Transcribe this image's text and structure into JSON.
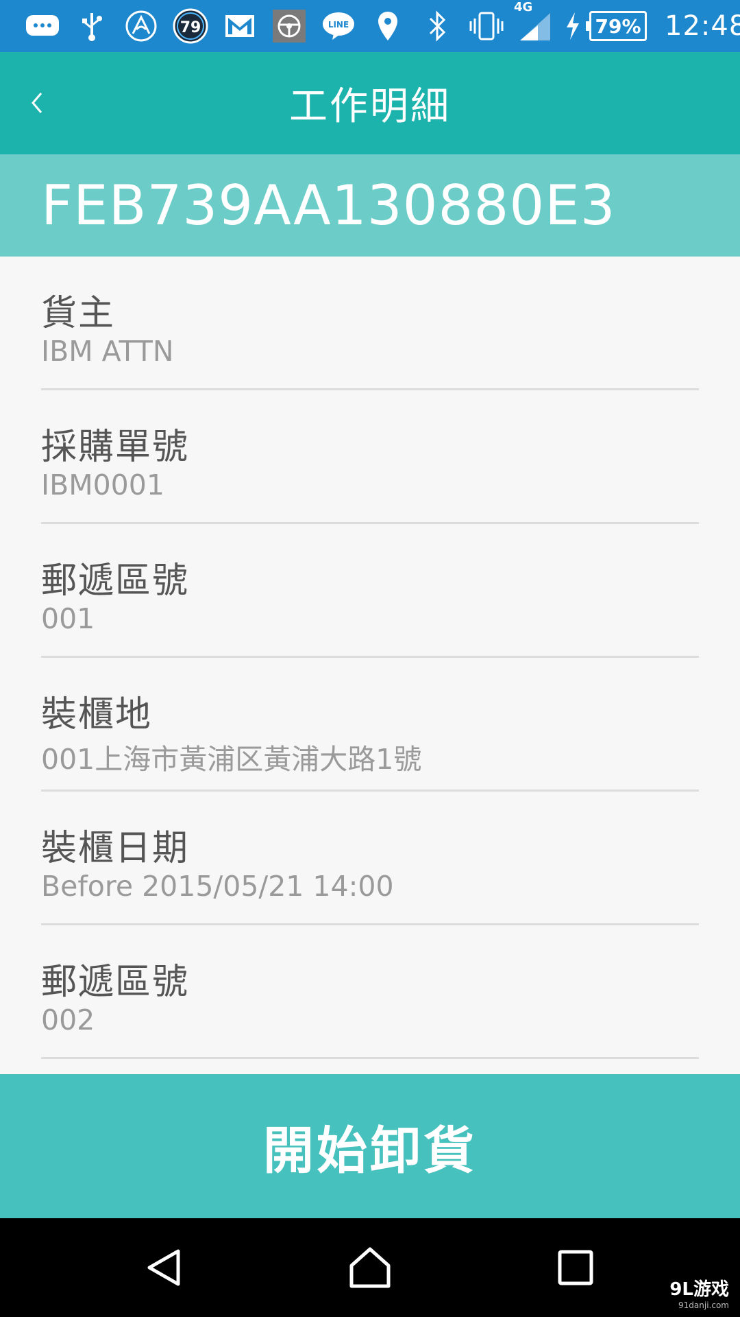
{
  "status_bar": {
    "time": "12:48",
    "battery": "79%",
    "network": "4G",
    "notification_badge": "79",
    "icons": [
      "chat-bubble-icon",
      "usb-icon",
      "airdroid-icon",
      "badge-79-icon",
      "gmail-icon",
      "steering-wheel-icon",
      "line-icon",
      "location-pin-icon",
      "bluetooth-icon",
      "vibrate-icon",
      "signal-icon",
      "charging-icon",
      "battery-icon"
    ]
  },
  "app_bar": {
    "title": "工作明細",
    "back_icon": "chevron-left-icon"
  },
  "job": {
    "id": "FEB739AA130880E3"
  },
  "fields": [
    {
      "label": "貨主",
      "value": "IBM ATTN"
    },
    {
      "label": "採購單號",
      "value": "IBM0001"
    },
    {
      "label": "郵遞區號",
      "value": "001"
    },
    {
      "label": "裝櫃地",
      "value": "001上海市黃浦区黃浦大路1號"
    },
    {
      "label": "裝櫃日期",
      "value": "Before 2015/05/21 14:00"
    },
    {
      "label": "郵遞區號",
      "value": "002"
    }
  ],
  "action": {
    "label": "開始卸貨"
  },
  "watermark": {
    "main": "9L游戏",
    "sub": "91danji.com"
  },
  "colors": {
    "status_bar": "#1e88cf",
    "app_bar": "#1cb3ad",
    "id_banner": "#6ccdc8",
    "action_button": "#47c1bd",
    "nav_bar": "#000000"
  }
}
